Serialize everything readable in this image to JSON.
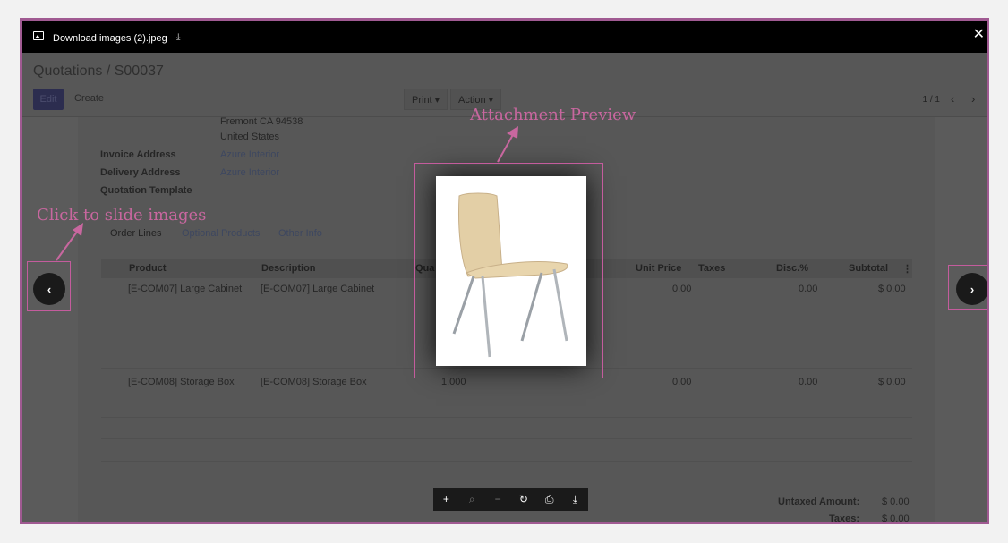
{
  "viewer": {
    "file_name": "Download images (2).jpeg",
    "close_label": "✕",
    "download_small": "⤓",
    "prev_label": "‹",
    "next_label": "›"
  },
  "annotations": {
    "attachment_preview": "Attachment Preview",
    "slide_images": "Click to slide images"
  },
  "toolbar": {
    "zoom_in": "+",
    "zoom_reset": "⌕",
    "zoom_out": "−",
    "rotate": "↻",
    "print": "⎙",
    "download": "⤓"
  },
  "page": {
    "breadcrumb": "Quotations / S00037",
    "edit_label": "Edit",
    "create_label": "Create",
    "print_label": "Print ▾",
    "action_label": "Action ▾",
    "pager": "1 / 1",
    "pager_prev": "‹",
    "pager_next": "›"
  },
  "address": {
    "line1": "Fremont CA 94538",
    "line2": "United States",
    "invoice_label": "Invoice Address",
    "invoice_value": "Azure Interior",
    "delivery_label": "Delivery Address",
    "delivery_value": "Azure Interior",
    "template_label": "Quotation Template"
  },
  "tabs": [
    "Order Lines",
    "Optional Products",
    "Other Info"
  ],
  "table": {
    "headers": [
      "Product",
      "Description",
      "Qua",
      "Unit Price",
      "Taxes",
      "Disc.%",
      "Subtotal",
      "⋮"
    ],
    "rows": [
      {
        "product": "[E-COM07] Large Cabinet",
        "description": "[E-COM07] Large Cabinet",
        "qty": "",
        "unit_price": "0.00",
        "disc": "0.00",
        "subtotal": "$ 0.00"
      },
      {
        "product": "[E-COM08] Storage Box",
        "description": "[E-COM08] Storage Box",
        "qty": "1.000",
        "unit_price": "0.00",
        "disc": "0.00",
        "subtotal": "$ 0.00"
      }
    ]
  },
  "totals": {
    "untaxed_label": "Untaxed Amount:",
    "untaxed_value": "$ 0.00",
    "taxes_label": "Taxes:",
    "taxes_value": "$ 0.00"
  },
  "colors": {
    "highlight": "#c45c9d",
    "annotation": "#c8679f"
  }
}
